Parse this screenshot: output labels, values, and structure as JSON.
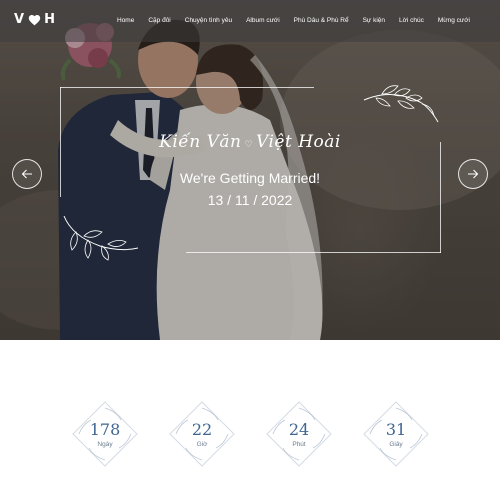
{
  "header": {
    "logo_left": "V",
    "logo_right": "H",
    "nav": [
      "Home",
      "Cặp đôi",
      "Chuyện tình yêu",
      "Album cưới",
      "Phù Dâu & Phù Rể",
      "Sự kiện",
      "Lời chúc",
      "Mừng cưới"
    ]
  },
  "hero": {
    "groom": "Kiến Văn",
    "bride": "Việt Hoài",
    "separator": "♡",
    "tagline": "We're Getting Married!",
    "date": "13 / 11 / 2022"
  },
  "countdown": [
    {
      "value": "178",
      "label": "Ngày"
    },
    {
      "value": "22",
      "label": "Giờ"
    },
    {
      "value": "24",
      "label": "Phút"
    },
    {
      "value": "31",
      "label": "Giây"
    }
  ],
  "icons": {
    "logo": "heart-icon",
    "prev": "arrow-left-icon",
    "next": "arrow-right-icon",
    "ornament": "floral-leaf-icon"
  },
  "colors": {
    "countdown_text": "#3f6591",
    "nav_bar": "#3c3c3e"
  }
}
